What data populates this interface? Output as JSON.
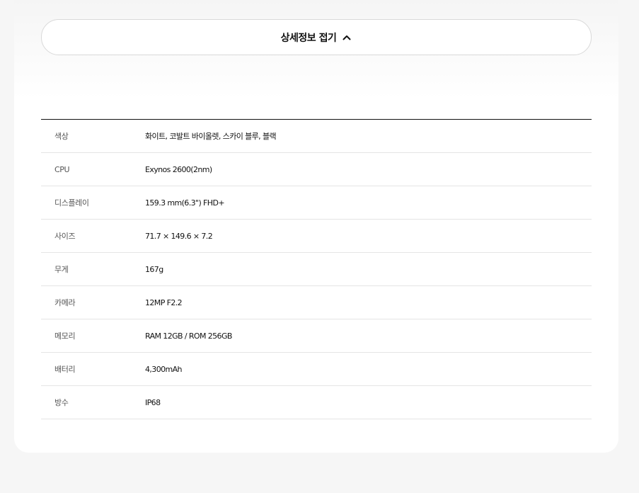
{
  "toggle": {
    "label": "상세정보 접기",
    "icon": "chevron-up-icon"
  },
  "specs": [
    {
      "key": "색상",
      "value": "화이트, 코발트 바이올렛, 스카이 블루, 블랙"
    },
    {
      "key": "CPU",
      "value": "Exynos 2600(2nm)"
    },
    {
      "key": "디스플레이",
      "value": "159.3 mm(6.3\") FHD+"
    },
    {
      "key": "사이즈",
      "value": "71.7 × 149.6 × 7.2"
    },
    {
      "key": "무게",
      "value": "167g"
    },
    {
      "key": "카메라",
      "value": "12MP F2.2"
    },
    {
      "key": "메모리",
      "value": "RAM 12GB / ROM 256GB"
    },
    {
      "key": "배터리",
      "value": "4,300mAh"
    },
    {
      "key": "방수",
      "value": "IP68"
    }
  ]
}
